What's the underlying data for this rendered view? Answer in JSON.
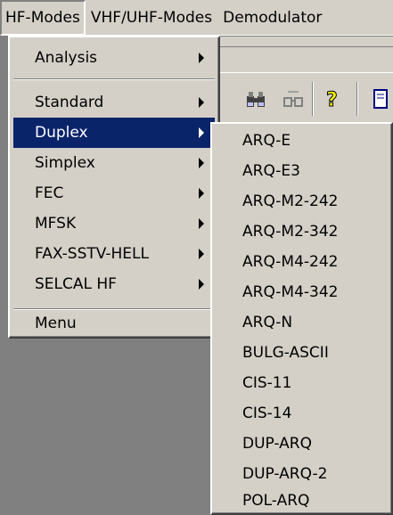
{
  "menubar": {
    "items": [
      {
        "label": "HF-Modes",
        "name": "menu-hf-modes",
        "active": true
      },
      {
        "label": "VHF/UHF-Modes",
        "name": "menu-vhf-uhf-modes",
        "active": false
      },
      {
        "label": "Demodulator",
        "name": "menu-demodulator",
        "active": false
      }
    ]
  },
  "hf_menu": {
    "items": [
      {
        "label": "Analysis",
        "has_submenu": true
      },
      {
        "label": "Standard",
        "has_submenu": true
      },
      {
        "label": "Duplex",
        "has_submenu": true,
        "highlighted": true
      },
      {
        "label": "Simplex",
        "has_submenu": true
      },
      {
        "label": "FEC",
        "has_submenu": true
      },
      {
        "label": "MFSK",
        "has_submenu": true
      },
      {
        "label": "FAX-SSTV-HELL",
        "has_submenu": true
      },
      {
        "label": "SELCAL HF",
        "has_submenu": true
      },
      {
        "label": "Menu",
        "has_submenu": false
      }
    ]
  },
  "duplex_submenu": {
    "items": [
      "ARQ-E",
      "ARQ-E3",
      "ARQ-M2-242",
      "ARQ-M2-342",
      "ARQ-M4-242",
      "ARQ-M4-342",
      "ARQ-N",
      "BULG-ASCII",
      "CIS-11",
      "CIS-14",
      "DUP-ARQ",
      "DUP-ARQ-2",
      "POL-ARQ"
    ]
  },
  "toolbar": {
    "icons": [
      "binoculars-icon",
      "glasses-icon",
      "help-icon"
    ]
  },
  "colors": {
    "menu_bg": "#d4d0c8",
    "highlight": "#0a246a",
    "desktop": "#808080"
  }
}
